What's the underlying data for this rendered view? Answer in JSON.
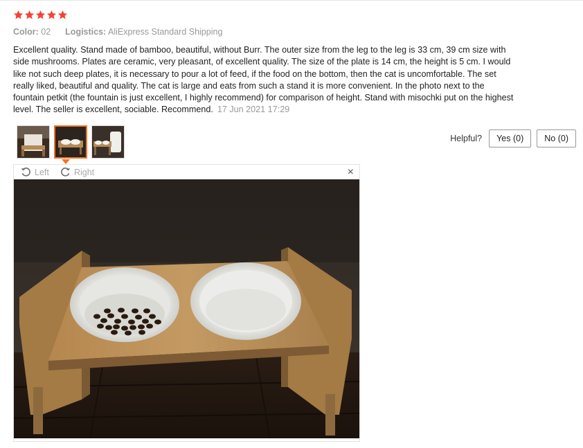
{
  "review": {
    "rating": 5,
    "color_label": "Color:",
    "color_value": "02",
    "logistics_label": "Logistics:",
    "logistics_value": "AliExpress Standard Shipping",
    "text": "Excellent quality. Stand made of bamboo, beautiful, without Burr. The outer size from the leg to the leg is 33 cm, 39 cm size with side mushrooms. Plates are ceramic, very pleasant, of excellent quality. The size of the plate is 14 cm, the height is 5 cm. I would like not such deep plates, it is necessary to pour a lot of feed, if the food on the bottom, then the cat is uncomfortable. The set really liked, beautiful and quality. The cat is large and eats from such a stand it is more convenient. In the photo next to the fountain petkit (the fountain is just excellent, I highly recommend) for comparison of height. Stand with misochki put on the highest level. The seller is excellent, sociable. Recommend.",
    "date": "17 Jun 2021 17:29"
  },
  "helpful": {
    "label": "Helpful?",
    "yes_label": "Yes (0)",
    "no_label": "No (0)"
  },
  "viewer": {
    "rotate_left_label": "Left",
    "rotate_right_label": "Right",
    "close_icon": "×",
    "selected_thumbnail": 2
  },
  "colors": {
    "star": "#f44336",
    "accent": "#f57224",
    "muted": "#999999"
  }
}
